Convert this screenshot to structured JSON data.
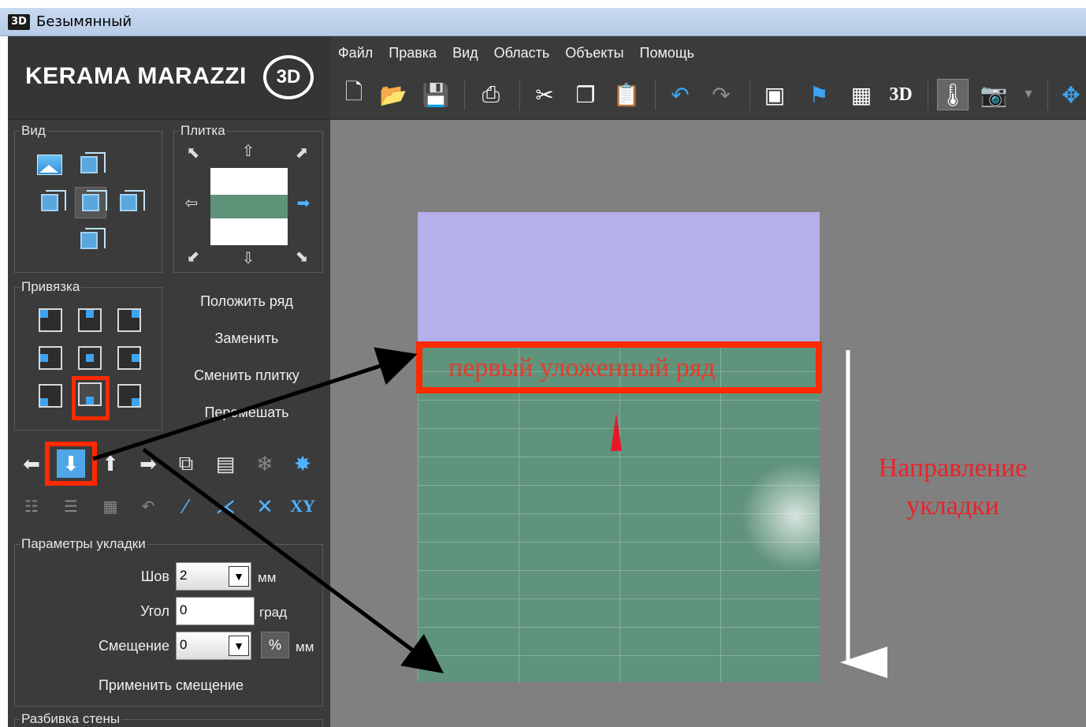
{
  "window": {
    "title": "Безымянный",
    "icon_label": "3D"
  },
  "logo": {
    "brand": "KERAMA MARAZZI",
    "badge": "3D"
  },
  "menu": [
    "Файл",
    "Правка",
    "Вид",
    "Область",
    "Объекты",
    "Помощь"
  ],
  "toolbar": {
    "view3d_label": "3D"
  },
  "panels": {
    "view_title": "Вид",
    "tile_title": "Плитка",
    "snap_title": "Привязка",
    "layout_title": "Параметры укладки",
    "wall_split_title": "Разбивка стены"
  },
  "actions": {
    "lay_row": "Положить ряд",
    "replace": "Заменить",
    "change_tile": "Сменить плитку",
    "shuffle": "Перемешать"
  },
  "toolicons": {
    "xy_label": "XY"
  },
  "params": {
    "seam_label": "Шов",
    "seam_value": "2",
    "seam_unit": "мм",
    "angle_label": "Угол",
    "angle_value": "0",
    "angle_unit": "град",
    "offset_label": "Смещение",
    "offset_value": "0",
    "offset_pct": "%",
    "offset_unit": "мм",
    "apply_offset": "Применить смещение"
  },
  "annotations": {
    "first_row": "первый уложенный ряд",
    "direction_line1": "Направление",
    "direction_line2": "укладки"
  },
  "colors": {
    "accent_red": "#ff2a00",
    "tile_green": "#5f937b",
    "wall_lilac": "#b5b0ea",
    "icon_blue": "#3ea3f0"
  }
}
